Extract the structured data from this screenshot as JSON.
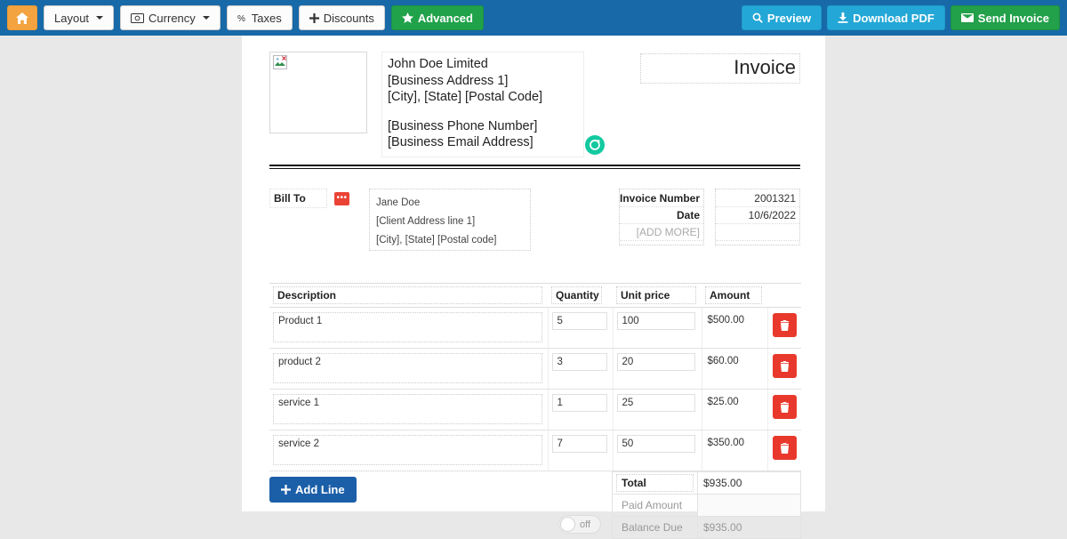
{
  "toolbar": {
    "left_buttons": [
      {
        "id": "home",
        "label": "",
        "icon": "home-icon"
      },
      {
        "id": "layout",
        "label": "Layout",
        "icon": "caret-down-icon"
      },
      {
        "id": "currency",
        "label": "Currency",
        "icon": "banknote-icon"
      },
      {
        "id": "taxes",
        "label": "Taxes",
        "icon": "percent-icon"
      },
      {
        "id": "discounts",
        "label": "Discounts",
        "icon": "plus-icon"
      },
      {
        "id": "advanced",
        "label": "Advanced",
        "icon": "star-icon"
      }
    ],
    "right_buttons": [
      {
        "id": "preview",
        "label": "Preview",
        "icon": "search-icon"
      },
      {
        "id": "download_pdf",
        "label": "Download PDF",
        "icon": "download-icon"
      },
      {
        "id": "send_invoice",
        "label": "Send Invoice",
        "icon": "envelope-icon"
      }
    ],
    "colors": {
      "bar": "#1769a8",
      "home": "#f3a33f",
      "advanced": "#20a24a",
      "cyan": "#23a7d6",
      "send": "#22a04a"
    }
  },
  "invoice": {
    "title": "Invoice",
    "business": {
      "name": "John Doe Limited",
      "address1": "[Business Address 1]",
      "address2": "[City], [State] [Postal Code]",
      "phone": "[Business Phone Number]",
      "email": "[Business Email Address]"
    },
    "bill_to": {
      "label": "Bill To",
      "client_name": "Jane Doe",
      "client_address1": "[Client Address line 1]",
      "client_address2": "[City], [State] [Postal code]"
    },
    "meta": {
      "invoice_number_label": "Invoice Number",
      "invoice_number_value": "2001321",
      "date_label": "Date",
      "date_value": "10/6/2022",
      "add_more_label": "[ADD MORE]"
    },
    "table": {
      "headers": {
        "description": "Description",
        "quantity": "Quantity",
        "unit_price": "Unit price",
        "amount": "Amount"
      },
      "rows": [
        {
          "description": "Product 1",
          "quantity": "5",
          "unit_price": "100",
          "amount": "$500.00"
        },
        {
          "description": "product 2",
          "quantity": "3",
          "unit_price": "20",
          "amount": "$60.00"
        },
        {
          "description": "service 1",
          "quantity": "1",
          "unit_price": "25",
          "amount": "$25.00"
        },
        {
          "description": "service 2",
          "quantity": "7",
          "unit_price": "50",
          "amount": "$350.00"
        }
      ]
    },
    "footer": {
      "add_line_label": "Add Line",
      "toggle_state": "off",
      "total_label": "Total",
      "total_value": "$935.00",
      "paid_amount_label": "Paid Amount",
      "paid_amount_value": "",
      "balance_due_label": "Balance Due",
      "balance_due_value": "$935.00"
    }
  }
}
